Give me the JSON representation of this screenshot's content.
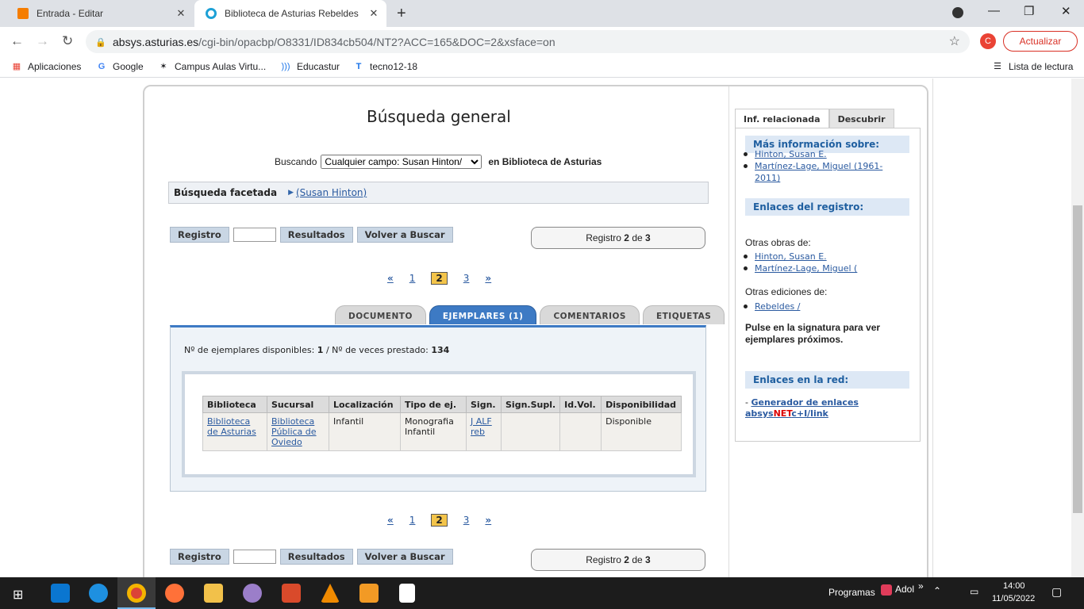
{
  "browser": {
    "tabs": [
      {
        "title": "Entrada - Editar"
      },
      {
        "title": "Biblioteca de Asturias Rebeldes"
      }
    ],
    "url_host": "absys.asturias.es",
    "url_path": "/cgi-bin/opacbp/O8331/ID834cb504/NT2?ACC=165&DOC=2&xsface=on",
    "avatar_letter": "C",
    "update_label": "Actualizar",
    "bookmarks": [
      "Aplicaciones",
      "Google",
      "Campus Aulas Virtu...",
      "Educastur",
      "tecno12-18"
    ],
    "reading_list": "Lista de lectura"
  },
  "page": {
    "title": "Búsqueda general",
    "search_label": "Buscando",
    "search_value": "Cualquier campo: Susan Hinton/",
    "search_scope": "en Biblioteca de Asturias",
    "facet_label": "Búsqueda facetada",
    "facet_term": "(Susan Hinton)",
    "btn_registro": "Registro",
    "btn_resultados": "Resultados",
    "btn_volver": "Volver a Buscar",
    "registro_prefix": "Registro",
    "registro_current": "2",
    "registro_of": "de",
    "registro_total": "3",
    "pager": {
      "first": "«",
      "p1": "1",
      "p2": "2",
      "p3": "3",
      "last": "»"
    },
    "tabs": [
      "DOCUMENTO",
      "EJEMPLARES (1)",
      "COMENTARIOS",
      "ETIQUETAS"
    ],
    "stats_available_label": "Nº de ejemplares disponibles:",
    "stats_available": "1",
    "stats_sep": "/",
    "stats_loans_label": "Nº de veces prestado:",
    "stats_loans": "134",
    "table": {
      "headers": [
        "Biblioteca",
        "Sucursal",
        "Localización",
        "Tipo de ej.",
        "Sign.",
        "Sign.Supl.",
        "Id.Vol.",
        "Disponibilidad"
      ],
      "row": {
        "biblioteca": "Biblioteca de Asturias",
        "sucursal": "Biblioteca Pública de Oviedo",
        "localizacion": "Infantil",
        "tipo": "Monografia Infantil",
        "sign": "J ALF reb",
        "sign_supl": "",
        "id_vol": "",
        "disponibilidad": "Disponible"
      }
    }
  },
  "sidebar": {
    "tabs": [
      "Inf. relacionada",
      "Descubrir"
    ],
    "mas_info": "Más información sobre:",
    "mas_info_items": [
      "Hinton, Susan E.",
      "Martínez-Lage, Miguel (1961-2011)"
    ],
    "enlaces_registro": "Enlaces del registro:",
    "otras_obras": "Otras obras de:",
    "otras_obras_items": [
      "Hinton, Susan E.",
      "Martínez-Lage, Miguel ("
    ],
    "otras_ediciones": "Otras ediciones de:",
    "otras_ediciones_items": [
      "Rebeldes /"
    ],
    "pulse_text": "Pulse en la signatura para ver ejemplares próximos.",
    "enlaces_red": "Enlaces en la red:",
    "gen_prefix": "- ",
    "gen_link_a": "Generador de enlaces absys",
    "gen_link_net": "NET",
    "gen_link_b": "c+I/link"
  },
  "taskbar": {
    "programs": "Programas",
    "user": "Adol",
    "time": "14:00",
    "date": "11/05/2022"
  }
}
